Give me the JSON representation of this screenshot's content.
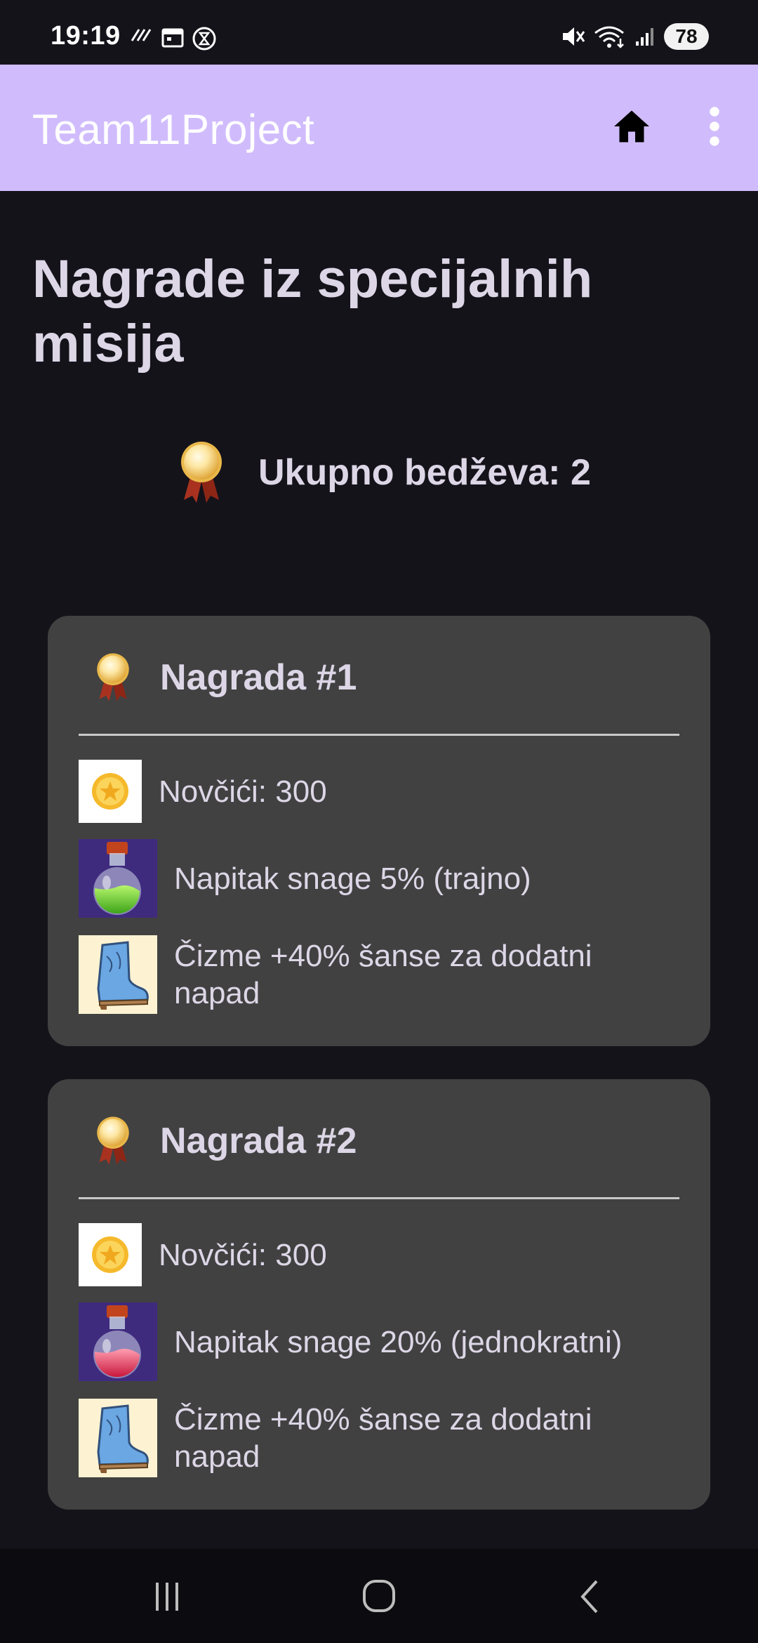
{
  "status_bar": {
    "time": "19:19",
    "battery": "78"
  },
  "app_bar": {
    "title": "Team11Project",
    "home_icon": "home-icon",
    "more_icon": "more-vertical-icon"
  },
  "page": {
    "title": "Nagrade iz specijalnih misija",
    "badge_count_text": "Ukupno bedževa: 2"
  },
  "rewards": [
    {
      "title": "Nagrada #1",
      "items": [
        {
          "icon": "coin-icon",
          "label": "Novčići: 300"
        },
        {
          "icon": "green-potion-icon",
          "label": "Napitak snage 5% (trajno)"
        },
        {
          "icon": "boots-icon",
          "label": "Čizme +40% šanse za dodatni napad"
        }
      ]
    },
    {
      "title": "Nagrada #2",
      "items": [
        {
          "icon": "coin-icon",
          "label": "Novčići: 300"
        },
        {
          "icon": "red-potion-icon",
          "label": "Napitak snage 20% (jednokratni)"
        },
        {
          "icon": "boots-icon",
          "label": "Čizme +40% šanse za dodatni napad"
        }
      ]
    }
  ],
  "colors": {
    "app_bar": "#d0bcfc",
    "background": "#15131a",
    "card": "#414141",
    "text": "#dcd6e6"
  }
}
